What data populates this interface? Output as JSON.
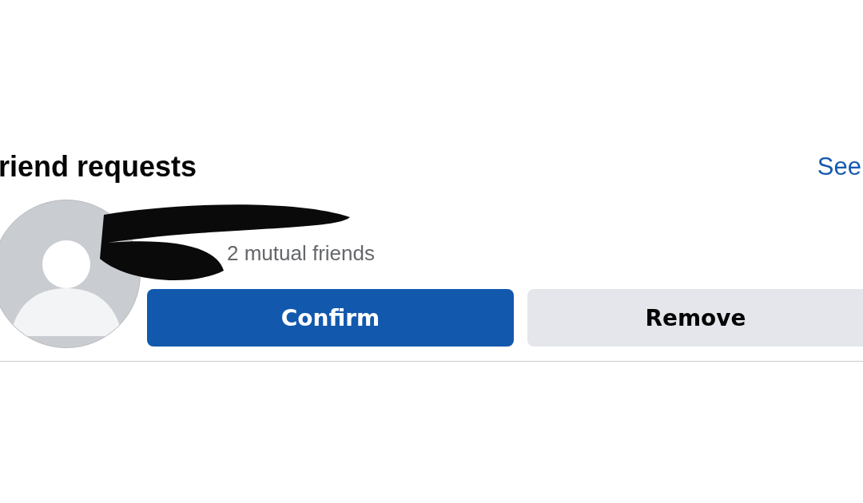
{
  "section": {
    "title": "riend requests",
    "link": "See"
  },
  "requests": [
    {
      "mutual": "2 mutual friends",
      "redacted": true,
      "buttons": [
        {
          "label": "Confirm",
          "kind": "primary"
        },
        {
          "label": "Remove",
          "kind": "secondary"
        }
      ]
    }
  ]
}
